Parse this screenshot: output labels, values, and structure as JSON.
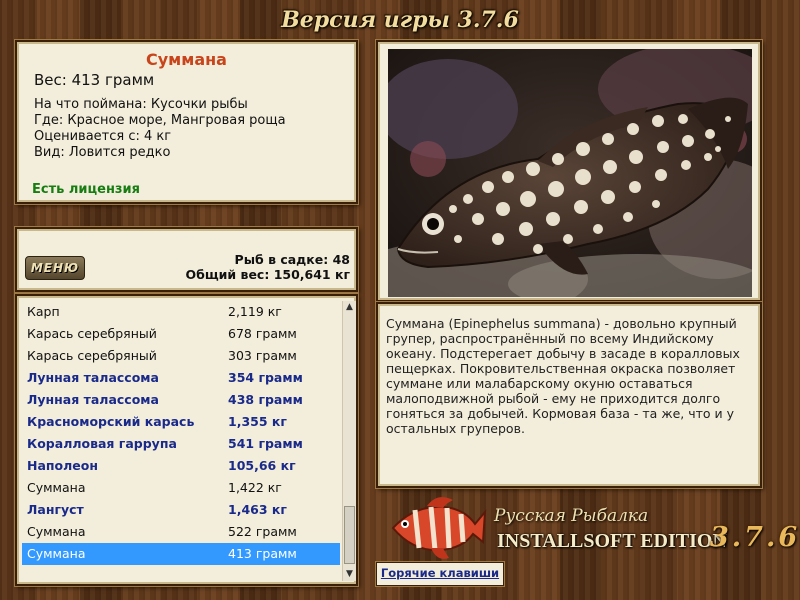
{
  "window": {
    "title": "Версия игры 3.7.6"
  },
  "fish": {
    "name": "Суммана",
    "weight": "Вес: 413 грамм",
    "caught_on": "На что поймана: Кусочки рыбы",
    "location": "Где: Красное море, Мангровая роща",
    "valued_from": "Оценивается с: 4 кг",
    "type": "Вид: Ловится редко",
    "license": "Есть лицензия"
  },
  "cage": {
    "menu_label": "МЕНЮ",
    "count": "Рыб в садке: 48",
    "total_weight": "Общий вес: 150,641 кг"
  },
  "catch_list": [
    {
      "name": "Карп",
      "weight": "2,119 кг",
      "bold": false
    },
    {
      "name": "Карась серебряный",
      "weight": "678 грамм",
      "bold": false
    },
    {
      "name": "Карась серебряный",
      "weight": "303 грамм",
      "bold": false
    },
    {
      "name": "Лунная талассома",
      "weight": "354 грамм",
      "bold": true
    },
    {
      "name": "Лунная талассома",
      "weight": "438 грамм",
      "bold": true
    },
    {
      "name": "Красноморский карась",
      "weight": "1,355 кг",
      "bold": true
    },
    {
      "name": "Коралловая гаррупа",
      "weight": "541 грамм",
      "bold": true
    },
    {
      "name": "Наполеон",
      "weight": "105,66 кг",
      "bold": true
    },
    {
      "name": "Суммана",
      "weight": "1,422 кг",
      "bold": false
    },
    {
      "name": "Лангуст",
      "weight": "1,463 кг",
      "bold": true
    },
    {
      "name": "Суммана",
      "weight": "522 грамм",
      "bold": false
    },
    {
      "name": "Суммана",
      "weight": "413 грамм",
      "bold": false,
      "selected": true
    }
  ],
  "description": "Суммана (Epinephelus summana) - довольно крупный групер, распространённый по всему Индийскому океану. Подстерегает добычу в засаде в коралловых пещерках. Покровительственная окраска позволяет суммане или малабарскому окуню оставаться малоподвижной рыбой - ему не приходится долго гоняться за добычей. Кормовая база - та же, что и у остальных груперов.",
  "logo": {
    "line1": "Русская Рыбалка",
    "line2": "INSTALLSOFT EDITION",
    "version": "3.7.6"
  },
  "hotkeys_label": "Горячие клавиши",
  "colors": {
    "name": "#c8441b",
    "license": "#177d12",
    "bold_item": "#1a2a8a",
    "selection": "#3399ff"
  }
}
